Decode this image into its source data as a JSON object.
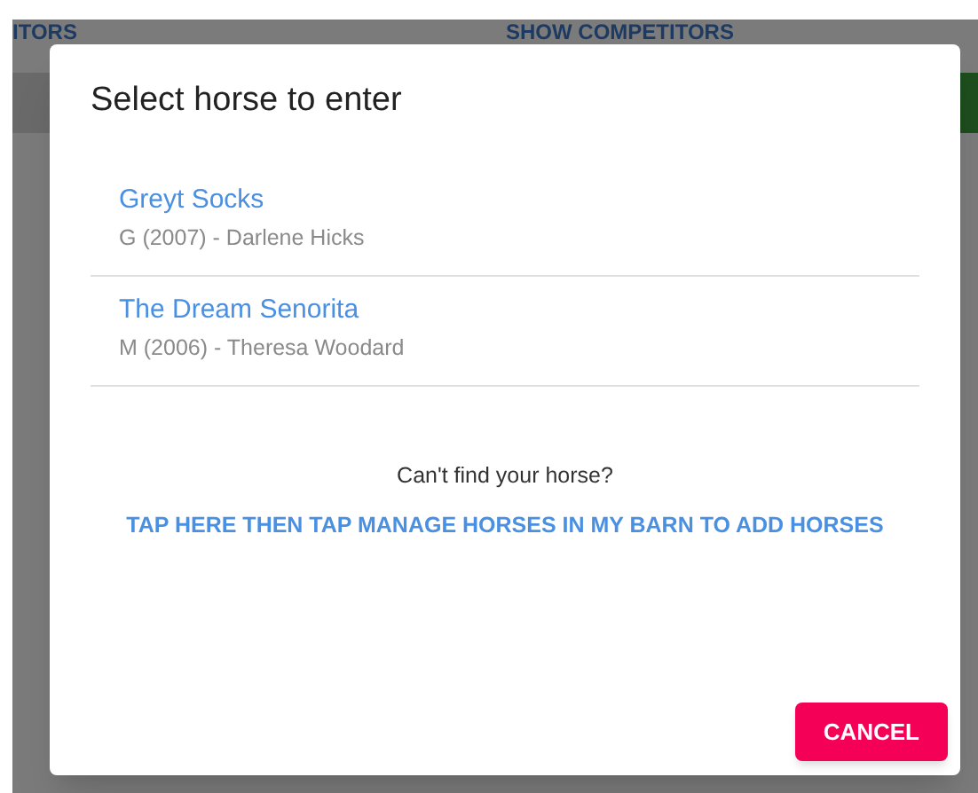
{
  "background": {
    "tabs": [
      {
        "label": "ITORS"
      },
      {
        "label": "SHOW COMPETITORS"
      }
    ]
  },
  "dialog": {
    "title": "Select horse to enter",
    "horses": [
      {
        "name": "Greyt Socks",
        "details": "G (2007) - Darlene Hicks"
      },
      {
        "name": "The Dream Senorita",
        "details": "M (2006) - Theresa Woodard"
      }
    ],
    "prompt": "Can't find your horse?",
    "link": "TAP HERE THEN TAP MANAGE HORSES IN MY BARN TO ADD HORSES",
    "buttons": [
      "CANCEL"
    ]
  }
}
